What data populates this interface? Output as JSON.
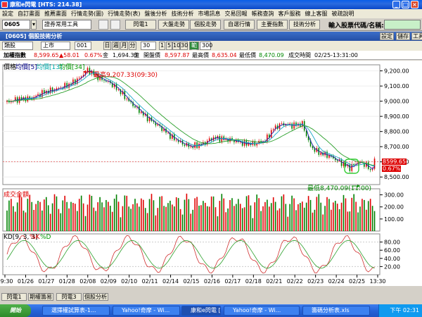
{
  "window": {
    "title": "康和e閃電 [HTS: 214.38]"
  },
  "menu": [
    "設定",
    "自訂畫面",
    "推薦畫面",
    "行情走勢(圖)",
    "行情走勢(表)",
    "盤後分析",
    "技術分析",
    "市場訊息",
    "交易回報",
    "帳務查詢",
    "客戶服務",
    "線上客服",
    "被疏說明"
  ],
  "toolbar": {
    "code": "0605",
    "combo": "證券常用工具",
    "buttons": [
      "閃電1",
      "大盤走勢",
      "個股走勢",
      "自選行情",
      "主要指數",
      "技術分析"
    ],
    "input_label": "輸入股票代碼/名稱:",
    "input_value": ""
  },
  "subwin": {
    "title": "[0605] 個股技術分析",
    "btns": [
      "設定",
      "儲存",
      "工具"
    ]
  },
  "controls": {
    "kind": "類股",
    "market": "上市",
    "num": "001",
    "periods": [
      "日",
      "週",
      "月",
      "分"
    ],
    "interval": "30",
    "scale": [
      "1",
      "5",
      "10",
      "30"
    ],
    "tick": "範圍",
    "count": "300"
  },
  "info": {
    "name": "加權指數",
    "price": "8,599.65",
    "chg": "▲58.01",
    "pct": "0.67%",
    "amt_label": "金",
    "amt": "1,694.33",
    "unit": "億",
    "open_label": "開盤價",
    "open": "8,597.87",
    "high_label": "最高價",
    "high": "8,635.04",
    "low_label": "最低價",
    "low": "8,470.09",
    "time_label": "成交時間",
    "time": "02/25-13:31:00"
  },
  "panel_labels": {
    "price": "價格",
    "ma1": "均價[5]",
    "ma2": "均價[13]",
    "ma3": "均價[34]",
    "vol": "成交金額",
    "kd": "KD[9, 3, 3]",
    "k": "%K",
    "d": "%D"
  },
  "annotations": {
    "high": "最高9,207.33(09:30)",
    "low": "最低8,470.09(11:00)"
  },
  "current": {
    "price": "8599.65",
    "pct": "0.67%"
  },
  "tabs": [
    "閃電1",
    "期權籌易",
    "閃電3",
    "個股分析"
  ],
  "taskbar": {
    "start": "開始",
    "tasks": [
      "選擇權試算表-1...",
      "Yahoo!奇摩 - Wi...",
      "康和e閃電 [HTS...",
      "Yahoo!奇摩 - Wi...",
      "籌碼分析表.xls"
    ],
    "clock": "下午 02:31"
  },
  "chart_data": {
    "type": "candlestick",
    "x_labels": [
      "09:30",
      "01/26",
      "01/27",
      "01/28",
      "02/08",
      "02/09",
      "02/10",
      "02/11",
      "02/14",
      "02/15",
      "02/16",
      "02/17",
      "02/18",
      "02/21",
      "02/22",
      "02/23",
      "02/24",
      "02/25",
      "13:30"
    ],
    "y_ticks": [
      "9,200.00",
      "9,100.00",
      "9,000.00",
      "8,900.00",
      "8,800.00",
      "8,700.00",
      "8,600.00",
      "8,500.00"
    ],
    "ylim": [
      8450,
      9240
    ],
    "close_path": [
      [
        0,
        8995
      ],
      [
        12,
        9015
      ],
      [
        24,
        9020
      ],
      [
        36,
        9060
      ],
      [
        48,
        9080
      ],
      [
        60,
        9110
      ],
      [
        70,
        9150
      ],
      [
        78,
        9207
      ],
      [
        90,
        9150
      ],
      [
        100,
        9120
      ],
      [
        110,
        9060
      ],
      [
        118,
        9000
      ],
      [
        126,
        8950
      ],
      [
        134,
        8900
      ],
      [
        142,
        8860
      ],
      [
        150,
        8820
      ],
      [
        160,
        8760
      ],
      [
        170,
        8720
      ],
      [
        178,
        8700
      ],
      [
        190,
        8720
      ],
      [
        200,
        8760
      ],
      [
        210,
        8750
      ],
      [
        220,
        8740
      ],
      [
        230,
        8720
      ],
      [
        240,
        8720
      ],
      [
        250,
        8740
      ],
      [
        258,
        8820
      ],
      [
        266,
        8850
      ],
      [
        276,
        8840
      ],
      [
        286,
        8850
      ],
      [
        294,
        8700
      ],
      [
        302,
        8660
      ],
      [
        312,
        8640
      ],
      [
        322,
        8600
      ],
      [
        332,
        8560
      ],
      [
        340,
        8600
      ],
      [
        348,
        8580
      ],
      [
        352,
        8540
      ],
      [
        356,
        8599.65
      ]
    ],
    "vol_ticks": [
      "300.00",
      "200.00",
      "100.00"
    ],
    "kd_ticks": [
      "80.00",
      "60.00",
      "40.00",
      "20.00"
    ]
  }
}
